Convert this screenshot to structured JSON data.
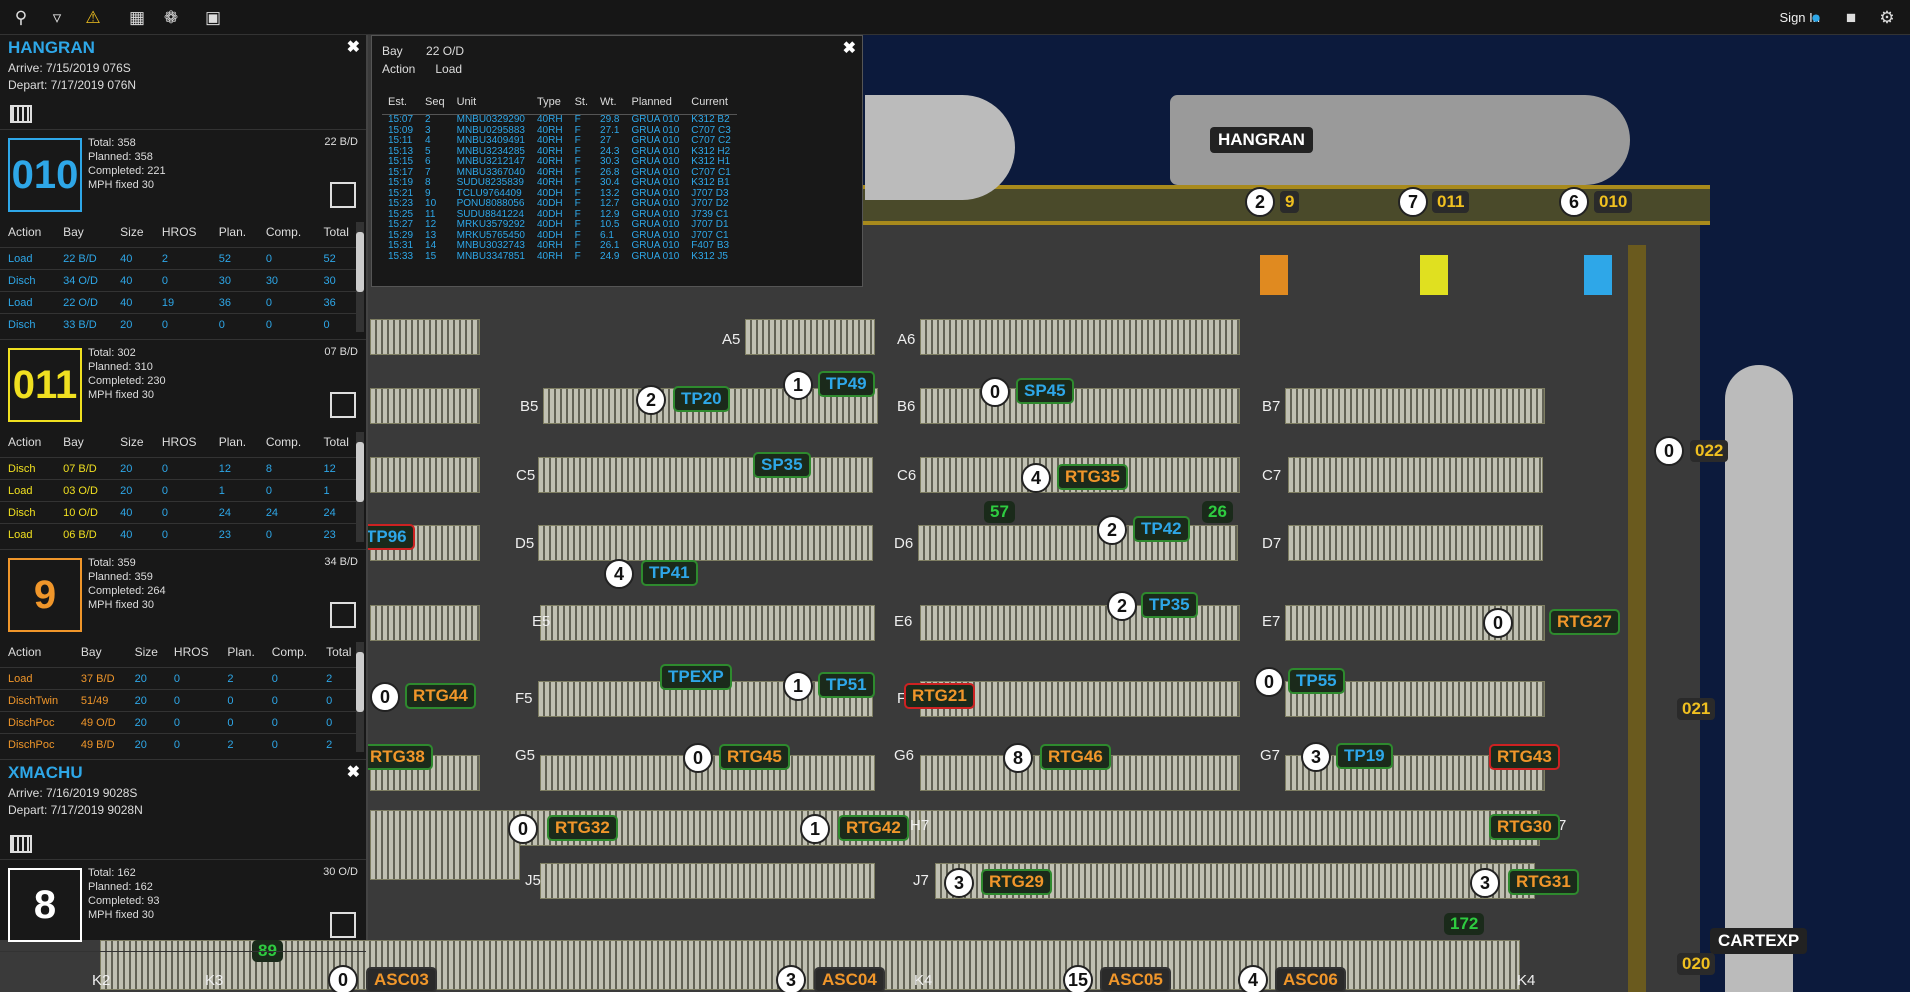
{
  "topbar": {
    "signin": "Sign In"
  },
  "vessels": [
    {
      "name": "HANGRAN",
      "arrive": "Arrive: 7/15/2019 076S",
      "depart": "Depart: 7/17/2019 076N"
    },
    {
      "name": "XMACHU",
      "arrive": "Arrive: 7/16/2019 9028S",
      "depart": "Depart: 7/17/2019 9028N"
    }
  ],
  "cranes": [
    {
      "id": "010",
      "color": "#2ea7e8",
      "bay": "22 B/D",
      "total": "Total: 358",
      "planned": "Planned: 358",
      "completed": "Completed: 221",
      "mph": "MPH fixed 30",
      "rows": [
        [
          "Load",
          "22 B/D",
          "40",
          "2",
          "52",
          "0",
          "52"
        ],
        [
          "Disch",
          "34 O/D",
          "40",
          "0",
          "30",
          "30",
          "30"
        ],
        [
          "Load",
          "22 O/D",
          "40",
          "19",
          "36",
          "0",
          "36"
        ],
        [
          "Disch",
          "33 B/D",
          "20",
          "0",
          "0",
          "0",
          "0"
        ]
      ]
    },
    {
      "id": "011",
      "color": "#f0e020",
      "bay": "07 B/D",
      "total": "Total: 302",
      "planned": "Planned: 310",
      "completed": "Completed: 230",
      "mph": "MPH fixed 30",
      "rows": [
        [
          "Disch",
          "07 B/D",
          "20",
          "0",
          "12",
          "8",
          "12"
        ],
        [
          "Load",
          "03 O/D",
          "20",
          "0",
          "1",
          "0",
          "1"
        ],
        [
          "Disch",
          "10 O/D",
          "40",
          "0",
          "24",
          "24",
          "24"
        ],
        [
          "Load",
          "06 B/D",
          "40",
          "0",
          "23",
          "0",
          "23"
        ]
      ]
    },
    {
      "id": "9",
      "color": "#f0962a",
      "bay": "34 B/D",
      "total": "Total: 359",
      "planned": "Planned: 359",
      "completed": "Completed: 264",
      "mph": "MPH fixed 30",
      "rows": [
        [
          "Load",
          "37 B/D",
          "20",
          "0",
          "2",
          "0",
          "2"
        ],
        [
          "DischTwin",
          "51/49",
          "20",
          "0",
          "0",
          "0",
          "0"
        ],
        [
          "DischPoc",
          "49 O/D",
          "20",
          "0",
          "0",
          "0",
          "0"
        ],
        [
          "DischPoc",
          "49 B/D",
          "20",
          "0",
          "2",
          "0",
          "2"
        ]
      ]
    }
  ],
  "crane_8": {
    "id": "8",
    "bay": "30 O/D",
    "total": "Total: 162",
    "planned": "Planned: 162",
    "completed": "Completed: 93",
    "mph": "MPH fixed 30"
  },
  "table_headers": [
    "Action",
    "Bay",
    "Size",
    "HROS",
    "Plan.",
    "Comp.",
    "Total"
  ],
  "workqueue": {
    "bay_label": "Bay",
    "bay_value": "22 O/D",
    "action_label": "Action",
    "action_value": "Load",
    "headers": [
      "Est.",
      "Seq",
      "Unit",
      "Type",
      "St.",
      "Wt.",
      "Planned",
      "Current"
    ],
    "rows": [
      [
        "15:07",
        "2",
        "MNBU0329290",
        "40RH",
        "F",
        "29.8",
        "GRUA 010",
        "K312 B2"
      ],
      [
        "15:09",
        "3",
        "MNBU0295883",
        "40RH",
        "F",
        "27.1",
        "GRUA 010",
        "C707 C3"
      ],
      [
        "15:11",
        "4",
        "MNBU3409491",
        "40RH",
        "F",
        "27",
        "GRUA 010",
        "C707 C2"
      ],
      [
        "15:13",
        "5",
        "MNBU3234285",
        "40RH",
        "F",
        "24.3",
        "GRUA 010",
        "K312 H2"
      ],
      [
        "15:15",
        "6",
        "MNBU3212147",
        "40RH",
        "F",
        "30.3",
        "GRUA 010",
        "K312 H1"
      ],
      [
        "15:17",
        "7",
        "MNBU3367040",
        "40RH",
        "F",
        "26.8",
        "GRUA 010",
        "C707 C1"
      ],
      [
        "15:19",
        "8",
        "SUDU8235839",
        "40RH",
        "F",
        "30.4",
        "GRUA 010",
        "K312 B1"
      ],
      [
        "15:21",
        "9",
        "TCLU9764409",
        "40DH",
        "F",
        "13.2",
        "GRUA 010",
        "J707 D3"
      ],
      [
        "15:23",
        "10",
        "PONU8088056",
        "40DH",
        "F",
        "12.7",
        "GRUA 010",
        "J707 D2"
      ],
      [
        "15:25",
        "11",
        "SUDU8841224",
        "40DH",
        "F",
        "12.9",
        "GRUA 010",
        "J739 C1"
      ],
      [
        "15:27",
        "12",
        "MRKU3579292",
        "40DH",
        "F",
        "10.5",
        "GRUA 010",
        "J707 D1"
      ],
      [
        "15:29",
        "13",
        "MRKU5765450",
        "40DH",
        "F",
        "6.1",
        "GRUA 010",
        "J707 C1"
      ],
      [
        "15:31",
        "14",
        "MNBU3032743",
        "40RH",
        "F",
        "26.1",
        "GRUA 010",
        "F407 B3"
      ],
      [
        "15:33",
        "15",
        "MNBU3347851",
        "40RH",
        "F",
        "24.9",
        "GRUA 010",
        "K312 J5"
      ]
    ]
  },
  "yard": {
    "blocks": [
      "A5",
      "A6",
      "B5",
      "B6",
      "B7",
      "C5",
      "C6",
      "C7",
      "D5",
      "D6",
      "D7",
      "E5",
      "E6",
      "E7",
      "F5",
      "F",
      "G5",
      "G6",
      "G7",
      "H7",
      "7",
      "J7",
      "J5",
      "K2",
      "K3",
      "K4",
      "K4"
    ],
    "vessel_labels": [
      "HANGRAN",
      "CARTEXP"
    ],
    "quay_cranes": [
      {
        "n": "2",
        "id": "9"
      },
      {
        "n": "7",
        "id": "011"
      },
      {
        "n": "6",
        "id": "010"
      }
    ],
    "side_cranes": [
      {
        "n": "0",
        "id": "022"
      },
      {
        "id": "021"
      },
      {
        "id": "020"
      }
    ],
    "chips": [
      "TP20",
      "TP49",
      "SP45",
      "SP35",
      "RTG35",
      "TP42",
      "TP96",
      "TP41",
      "TP35",
      "RTG27",
      "TPEXP",
      "TP51",
      "RTG21",
      "TP55",
      "RTG44",
      "RTG38",
      "RTG45",
      "RTG46",
      "TP19",
      "RTG43",
      "RTG32",
      "RTG42",
      "RTG30",
      "RTG29",
      "RTG31",
      "ASC03",
      "ASC04",
      "ASC05",
      "ASC06"
    ],
    "counts": [
      "57",
      "26",
      "172",
      "89"
    ],
    "circles": [
      "2",
      "1",
      "0",
      "4",
      "2",
      "2",
      "4",
      "0",
      "0",
      "1",
      "0",
      "0",
      "8",
      "3",
      "0",
      "1",
      "3",
      "3",
      "0",
      "3",
      "15",
      "4"
    ]
  }
}
